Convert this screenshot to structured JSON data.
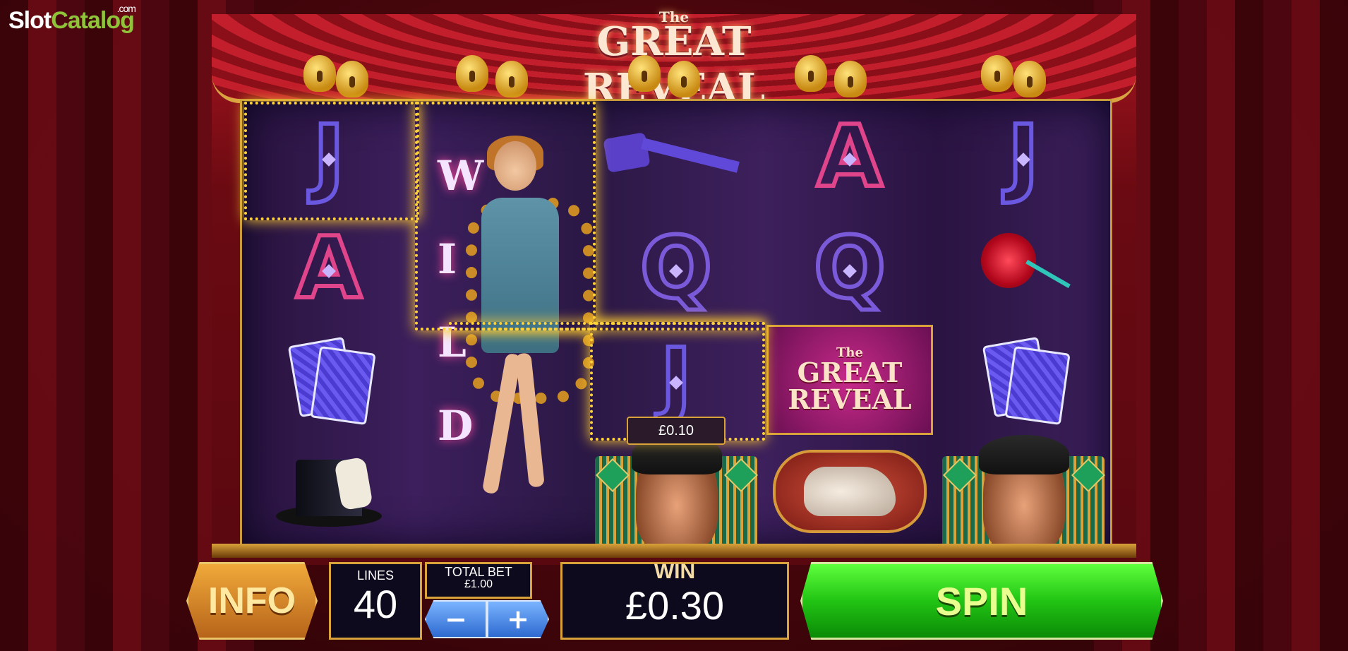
{
  "site_logo": {
    "part1": "Slot",
    "part2": "Catalog",
    "suffix": ".com"
  },
  "game": {
    "title_small": "The",
    "title": "GREAT REVEAL"
  },
  "reels": [
    [
      "J",
      "A",
      "cards",
      "hat"
    ],
    [
      "wild",
      "wild",
      "wild",
      "wild"
    ],
    [
      "key",
      "Q",
      "J",
      "magician"
    ],
    [
      "A",
      "Q",
      "logo",
      "bunny"
    ],
    [
      "J",
      "rose",
      "cards",
      "magician"
    ]
  ],
  "wild_text": "WILD",
  "logo_tile": {
    "small": "The",
    "line1": "GREAT",
    "line2": "REVEAL"
  },
  "line_win_tag": "£0.10",
  "controls": {
    "info_label": "INFO",
    "lines_label": "LINES",
    "lines_value": "40",
    "total_bet_label": "TOTAL BET",
    "total_bet_value": "£1.00",
    "minus_label": "−",
    "plus_label": "+",
    "win_label": "WIN",
    "win_value": "£0.30",
    "spin_label": "SPIN"
  }
}
